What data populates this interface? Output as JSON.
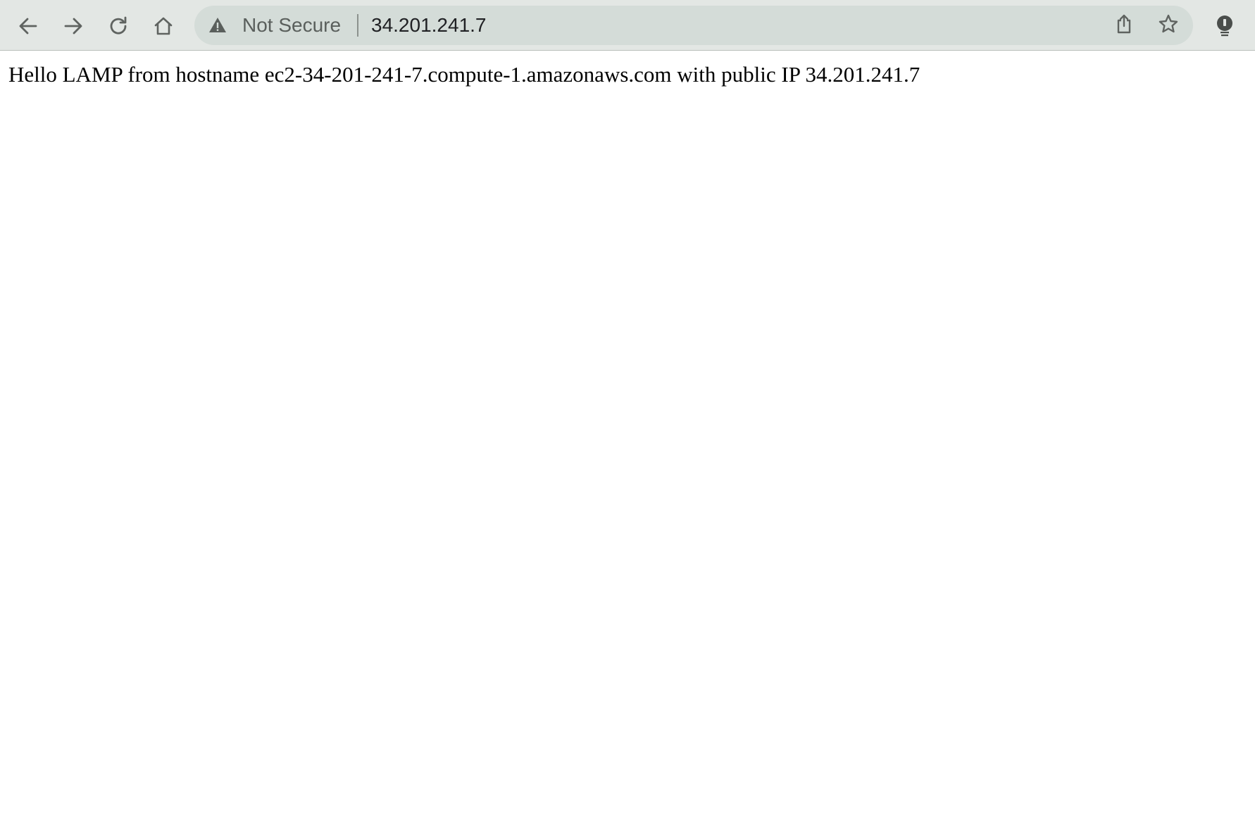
{
  "toolbar": {
    "back_icon": "arrow-left-icon",
    "forward_icon": "arrow-right-icon",
    "reload_icon": "reload-icon",
    "home_icon": "home-icon",
    "extension_icon": "lightbulb-icon"
  },
  "omnibox": {
    "security_icon": "warning-triangle-icon",
    "security_label": "Not Secure",
    "url": "34.201.241.7",
    "share_icon": "share-icon",
    "bookmark_icon": "star-icon"
  },
  "page": {
    "body_text": "Hello LAMP from hostname ec2-34-201-241-7.compute-1.amazonaws.com with public IP 34.201.241.7"
  },
  "colors": {
    "toolbar_bg": "#e3e7e4",
    "omnibox_bg": "#d4dcd8",
    "icon_color": "#5f6360",
    "text_color": "#000000"
  }
}
